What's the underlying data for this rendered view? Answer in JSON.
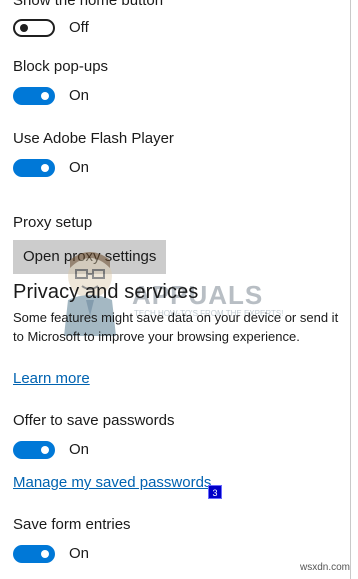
{
  "settings": {
    "home_button": {
      "label": "Show the home button",
      "state": "Off"
    },
    "block_popups": {
      "label": "Block pop-ups",
      "state": "On"
    },
    "flash": {
      "label": "Use Adobe Flash Player",
      "state": "On"
    },
    "proxy": {
      "label": "Proxy setup",
      "button": "Open proxy settings"
    }
  },
  "privacy": {
    "heading": "Privacy and services",
    "description": "Some features might save data on your device or send it to Microsoft to improve your browsing experience.",
    "learn_more": "Learn more",
    "offer_passwords": {
      "label": "Offer to save passwords",
      "state": "On"
    },
    "manage_passwords": "Manage my saved passwords",
    "step_badge": "3",
    "form_entries": {
      "label": "Save form entries",
      "state": "On"
    }
  },
  "watermark": {
    "brand": "APPUALS",
    "tagline": "TECH HOW-TO'S FROM THE EXPERTS!"
  },
  "footer": {
    "site": "wsxdn.com"
  },
  "colors": {
    "accent": "#0078d7",
    "link": "#0063b1",
    "button_bg": "#cccccc",
    "badge": "#0000c8"
  }
}
